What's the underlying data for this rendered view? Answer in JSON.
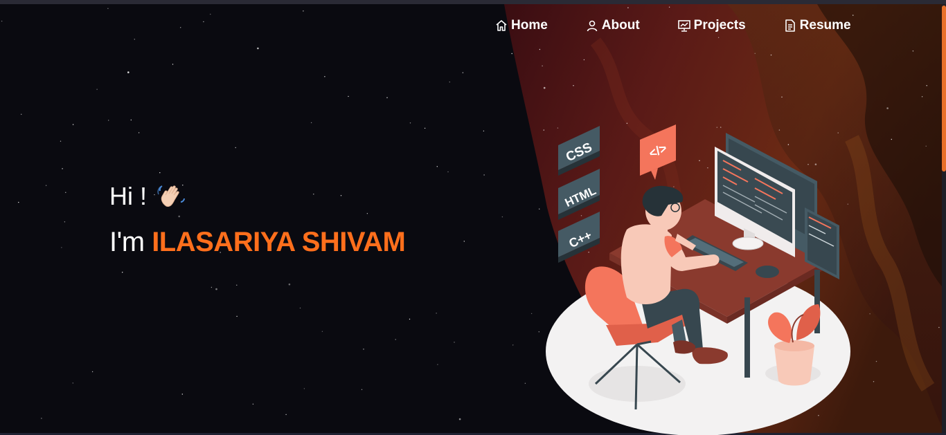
{
  "nav": {
    "items": [
      {
        "label": "Home",
        "icon": "home-icon"
      },
      {
        "label": "About",
        "icon": "user-icon"
      },
      {
        "label": "Projects",
        "icon": "presentation-icon"
      },
      {
        "label": "Resume",
        "icon": "document-icon"
      }
    ]
  },
  "hero": {
    "greeting": "Hi !",
    "wave_emoji": "waving-hand-icon",
    "intro_prefix": "I'm ",
    "name": "ILASARIYA SHIVAM"
  },
  "illustration": {
    "badges": [
      "CSS",
      "HTML",
      "C++"
    ],
    "code_bubble": "</>"
  },
  "colors": {
    "background": "#0a0a10",
    "accent": "#ff6f1c",
    "text": "#ffffff",
    "illustration_primary": "#f4755c"
  }
}
